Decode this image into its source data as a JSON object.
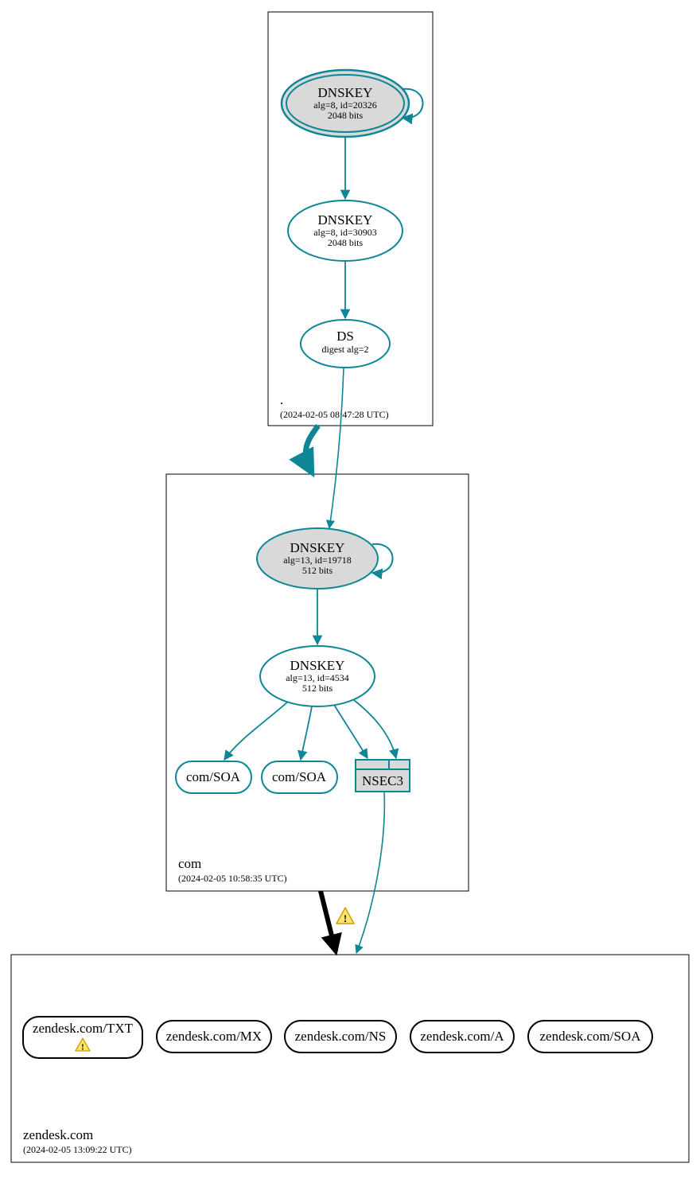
{
  "colors": {
    "teal": "#0d8696",
    "gray_fill": "#d9d9d9",
    "warn_fill": "#ffe36e",
    "warn_stroke": "#c9a400",
    "node_fill": "#ffffff",
    "black": "#000000",
    "box_stroke": "#000000"
  },
  "zones": {
    "root": {
      "label": ".",
      "timestamp": "(2024-02-05 08:47:28 UTC)"
    },
    "com": {
      "label": "com",
      "timestamp": "(2024-02-05 10:58:35 UTC)"
    },
    "zendesk": {
      "label": "zendesk.com",
      "timestamp": "(2024-02-05 13:09:22 UTC)"
    }
  },
  "nodes": {
    "root_ksk": {
      "title": "DNSKEY",
      "line2": "alg=8, id=20326",
      "line3": "2048 bits"
    },
    "root_zsk": {
      "title": "DNSKEY",
      "line2": "alg=8, id=30903",
      "line3": "2048 bits"
    },
    "root_ds": {
      "title": "DS",
      "line2": "digest alg=2"
    },
    "com_ksk": {
      "title": "DNSKEY",
      "line2": "alg=13, id=19718",
      "line3": "512 bits"
    },
    "com_zsk": {
      "title": "DNSKEY",
      "line2": "alg=13, id=4534",
      "line3": "512 bits"
    },
    "com_soa1": {
      "title": "com/SOA"
    },
    "com_soa2": {
      "title": "com/SOA"
    },
    "com_nsec3": {
      "title": "NSEC3"
    },
    "zd_txt": {
      "title": "zendesk.com/TXT"
    },
    "zd_mx": {
      "title": "zendesk.com/MX"
    },
    "zd_ns": {
      "title": "zendesk.com/NS"
    },
    "zd_a": {
      "title": "zendesk.com/A"
    },
    "zd_soa": {
      "title": "zendesk.com/SOA"
    }
  }
}
